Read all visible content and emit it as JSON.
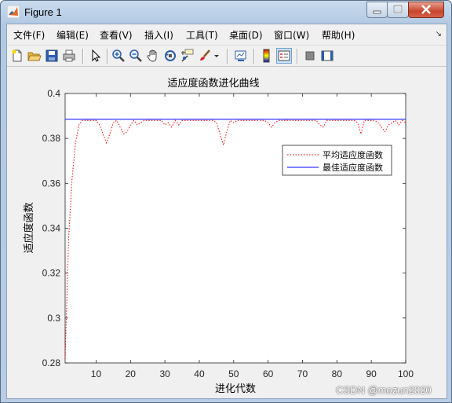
{
  "window": {
    "title": "Figure 1"
  },
  "menu": {
    "items": [
      "文件(F)",
      "编辑(E)",
      "查看(V)",
      "插入(I)",
      "工具(T)",
      "桌面(D)",
      "窗口(W)",
      "帮助(H)"
    ]
  },
  "toolbar": {
    "icons": [
      "new-figure-icon",
      "open-file-icon",
      "save-icon",
      "print-icon",
      "select-arrow-icon",
      "zoom-in-icon",
      "zoom-out-icon",
      "pan-hand-icon",
      "rotate-3d-icon",
      "data-cursor-icon",
      "brush-icon",
      "brush-dropdown-icon",
      "link-plot-icon",
      "colorbar-icon",
      "legend-icon",
      "hide-plot-tools-icon",
      "show-plot-tools-icon"
    ]
  },
  "chart_data": {
    "type": "line",
    "title": "适应度函数进化曲线",
    "xlabel": "进化代数",
    "ylabel": "适应度函数",
    "xlim": [
      1,
      100
    ],
    "ylim": [
      0.28,
      0.4
    ],
    "xticks": [
      10,
      20,
      30,
      40,
      50,
      60,
      70,
      80,
      90,
      100
    ],
    "yticks": [
      0.28,
      0.3,
      0.32,
      0.34,
      0.36,
      0.38,
      0.4
    ],
    "ytick_labels": [
      "0.28",
      "0.3",
      "0.32",
      "0.34",
      "0.36",
      "0.38",
      "0.4"
    ],
    "grid": false,
    "legend_position": "right, upper-middle",
    "series": [
      {
        "name": "平均适应度函数",
        "color": "#ff0000",
        "style": "dotted",
        "x": [
          1,
          2,
          3,
          4,
          5,
          6,
          7,
          8,
          9,
          10,
          11,
          12,
          13,
          14,
          15,
          16,
          17,
          18,
          19,
          20,
          21,
          22,
          23,
          24,
          25,
          26,
          27,
          28,
          29,
          30,
          31,
          32,
          33,
          34,
          35,
          36,
          37,
          38,
          39,
          40,
          41,
          42,
          43,
          44,
          45,
          46,
          47,
          48,
          49,
          50,
          51,
          52,
          53,
          54,
          55,
          56,
          57,
          58,
          59,
          60,
          61,
          62,
          63,
          64,
          65,
          66,
          67,
          68,
          69,
          70,
          71,
          72,
          73,
          74,
          75,
          76,
          77,
          78,
          79,
          80,
          81,
          82,
          83,
          84,
          85,
          86,
          87,
          88,
          89,
          90,
          91,
          92,
          93,
          94,
          95,
          96,
          97,
          98,
          99,
          100
        ],
        "y": [
          0.282,
          0.335,
          0.362,
          0.378,
          0.386,
          0.388,
          0.388,
          0.388,
          0.388,
          0.388,
          0.386,
          0.382,
          0.378,
          0.382,
          0.387,
          0.388,
          0.385,
          0.382,
          0.383,
          0.386,
          0.388,
          0.386,
          0.387,
          0.388,
          0.388,
          0.388,
          0.388,
          0.388,
          0.388,
          0.386,
          0.387,
          0.385,
          0.388,
          0.386,
          0.388,
          0.388,
          0.388,
          0.388,
          0.388,
          0.388,
          0.388,
          0.388,
          0.388,
          0.388,
          0.387,
          0.382,
          0.377,
          0.383,
          0.388,
          0.387,
          0.388,
          0.388,
          0.388,
          0.388,
          0.388,
          0.388,
          0.388,
          0.388,
          0.388,
          0.387,
          0.385,
          0.387,
          0.388,
          0.388,
          0.388,
          0.388,
          0.388,
          0.388,
          0.388,
          0.388,
          0.388,
          0.388,
          0.388,
          0.388,
          0.386,
          0.385,
          0.388,
          0.388,
          0.388,
          0.388,
          0.388,
          0.388,
          0.388,
          0.388,
          0.388,
          0.387,
          0.382,
          0.388,
          0.388,
          0.388,
          0.388,
          0.387,
          0.385,
          0.383,
          0.386,
          0.387,
          0.388,
          0.386,
          0.388,
          0.387
        ]
      },
      {
        "name": "最佳适应度函数",
        "color": "#0000ff",
        "style": "solid",
        "x": [
          1,
          100
        ],
        "y": [
          0.3885,
          0.3885
        ]
      }
    ]
  },
  "watermark": "CSDN @mozun2020"
}
